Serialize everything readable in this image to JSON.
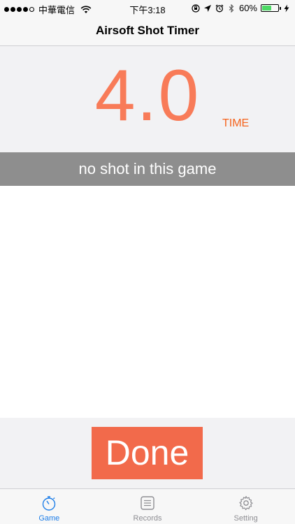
{
  "status_bar": {
    "carrier": "中華電信",
    "time": "下午3:18",
    "battery_percent": "60%",
    "battery_level": 0.6,
    "battery_color": "#4cd964"
  },
  "nav": {
    "title": "Airsoft Shot Timer"
  },
  "timer": {
    "value": "4.0",
    "unit_label": "TIME",
    "value_color": "#f87b58"
  },
  "shot_status": {
    "message": "no shot in this game"
  },
  "actions": {
    "done_label": "Done",
    "done_color": "#f26a4b"
  },
  "tabs": [
    {
      "label": "Game",
      "icon": "stopwatch-icon",
      "active": true
    },
    {
      "label": "Records",
      "icon": "list-icon",
      "active": false
    },
    {
      "label": "Setting",
      "icon": "gear-icon",
      "active": false
    }
  ],
  "colors": {
    "accent": "#1e7ee8",
    "inactive": "#8e8e93"
  }
}
